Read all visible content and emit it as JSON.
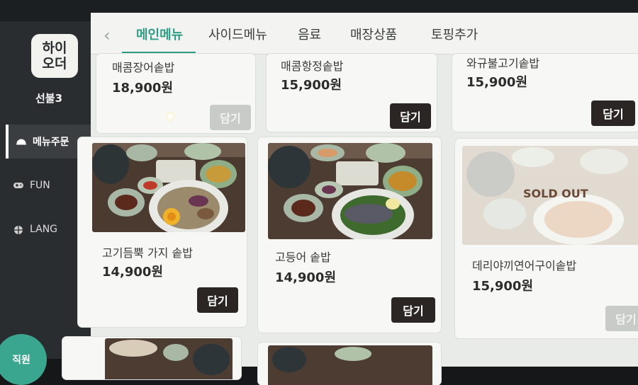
{
  "sidebar": {
    "logo": "하이\n오더",
    "table": "선불3",
    "items": [
      {
        "label": "메뉴주문",
        "active": true
      },
      {
        "label": "FUN",
        "active": false
      },
      {
        "label": "LANG",
        "active": false
      }
    ],
    "staff_button": "직원"
  },
  "tabs": [
    "메인메뉴",
    "사이드메뉴",
    "음료",
    "매장상품",
    "토핑추가"
  ],
  "add_label": "담기",
  "sold_out_label": "SOLD OUT",
  "items": [
    {
      "name": "매콤장어솥밥",
      "price": "18,900원",
      "enabled": false
    },
    {
      "name": "매콤항정솥밥",
      "price": "15,900원",
      "enabled": true
    },
    {
      "name": "와규불고기솥밥",
      "price": "15,900원",
      "enabled": true
    },
    {
      "name": "고기듬뿍 가지 솥밥",
      "price": "14,900원",
      "enabled": true
    },
    {
      "name": "고등어 솥밥",
      "price": "14,900원",
      "enabled": true
    },
    {
      "name": "데리야끼연어구이솥밥",
      "price": "15,900원",
      "enabled": false,
      "sold_out": true
    }
  ],
  "colors": {
    "accent": "#2f9c86",
    "add_button": "#2b2624",
    "sidebar": "#2a2d2f"
  }
}
